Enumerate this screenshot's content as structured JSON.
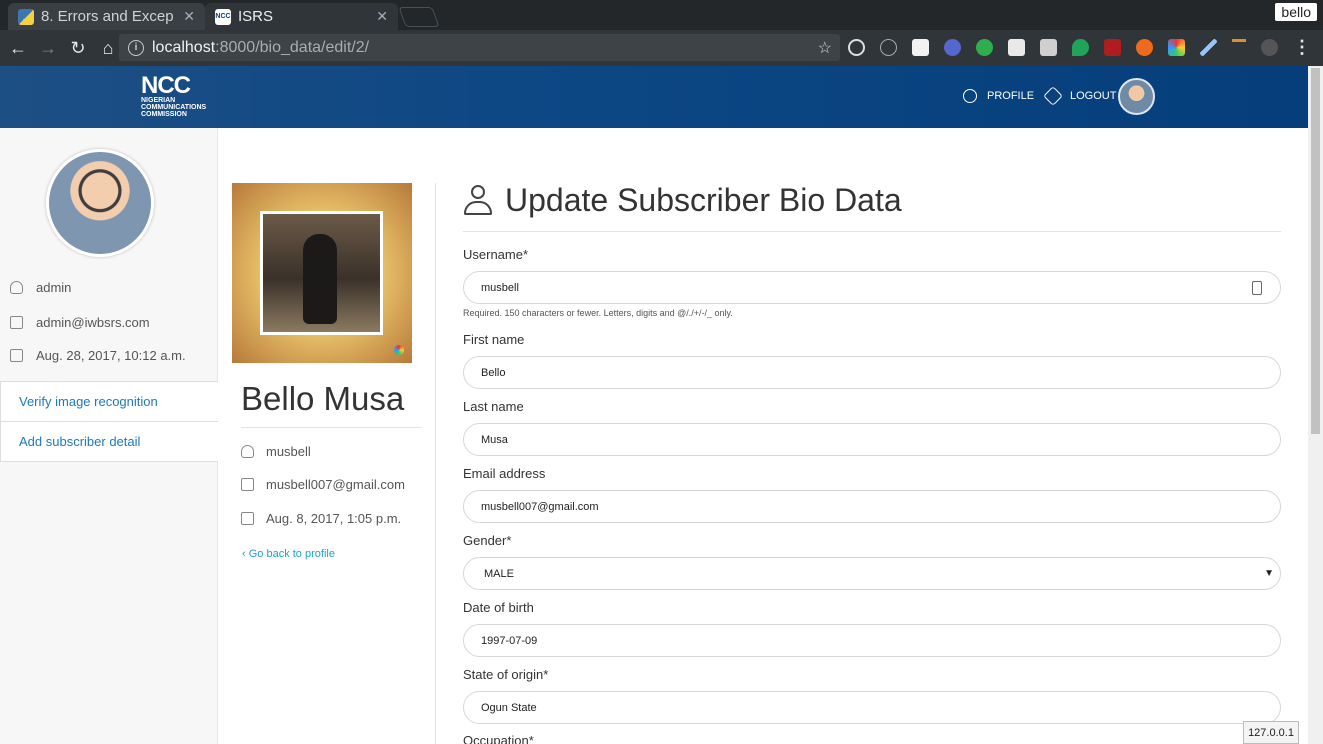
{
  "browser": {
    "tabs": [
      {
        "title": "8. Errors and Excep",
        "favicon": "python-icon"
      },
      {
        "title": "ISRS",
        "favicon": "ncc-icon"
      }
    ],
    "url_host": "localhost",
    "url_path": ":8000/bio_data/edit/2/",
    "profile_name": "bello"
  },
  "header": {
    "logo_main": "NCC",
    "logo_line1": "Nigerian",
    "logo_line2": "Communications",
    "logo_line3": "Commission",
    "profile_label": "PROFILE",
    "logout_label": "LOGOUT"
  },
  "sidebar": {
    "username": "admin",
    "email": "admin@iwbsrs.com",
    "joined": "Aug. 28, 2017, 10:12 a.m.",
    "menu": [
      {
        "label": "Verify image recognition"
      },
      {
        "label": "Add subscriber detail"
      }
    ]
  },
  "subscriber": {
    "full_name": "Bello Musa",
    "username": "musbell",
    "email": "musbell007@gmail.com",
    "joined": "Aug. 8, 2017, 1:05 p.m.",
    "back_link": "Go back to profile"
  },
  "form": {
    "title": "Update Subscriber Bio Data",
    "fields": [
      {
        "label": "Username*",
        "value": "musbell",
        "help": "Required. 150 characters or fewer. Letters, digits and @/./+/-/_ only."
      },
      {
        "label": "First name",
        "value": "Bello"
      },
      {
        "label": "Last name",
        "value": "Musa"
      },
      {
        "label": "Email address",
        "value": "musbell007@gmail.com"
      },
      {
        "label": "Gender*",
        "value": "MALE"
      },
      {
        "label": "Date of birth",
        "value": "1997-07-09"
      },
      {
        "label": "State of origin*",
        "value": "Ogun State"
      },
      {
        "label": "Occupation*"
      }
    ]
  },
  "status_bar": "127.0.0.1"
}
